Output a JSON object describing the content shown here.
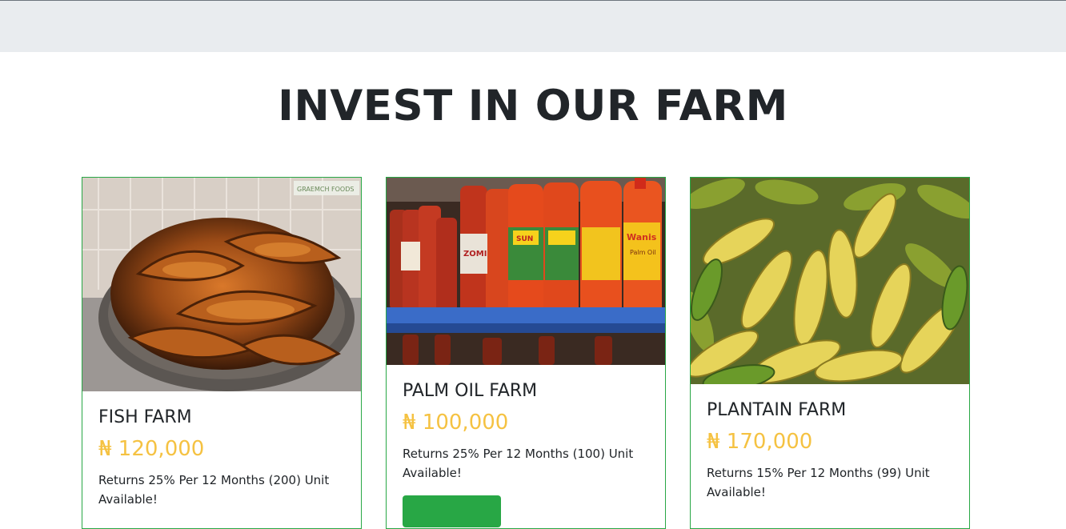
{
  "page": {
    "heading": "INVEST IN OUR FARM"
  },
  "cards": [
    {
      "title": "FISH FARM",
      "price": "₦ 120,000",
      "description": "Returns 25% Per 12 Months (200) Unit Available!",
      "image_watermark": "GRAEMCH FOODS"
    },
    {
      "title": "PALM OIL FARM",
      "price": "₦ 100,000",
      "description": "Returns 25% Per 12 Months (100) Unit Available!",
      "button_label": "",
      "bottle_labels": [
        "ZOMI",
        "SUN",
        "Wanis",
        "Palm Oil"
      ]
    },
    {
      "title": "PLANTAIN FARM",
      "price": "₦ 170,000",
      "description": "Returns 15% Per 12 Months (99) Unit Available!"
    }
  ],
  "colors": {
    "topbar": "#e9ecef",
    "card_border": "#28a745",
    "price": "#f5c242",
    "button": "#28a745"
  }
}
